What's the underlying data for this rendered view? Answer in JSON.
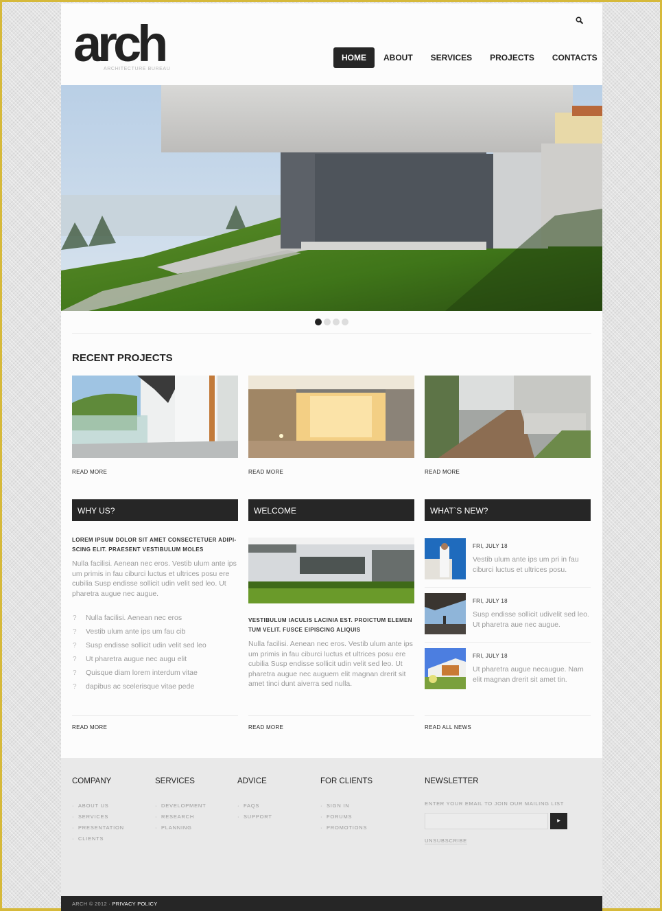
{
  "header": {
    "logo": "arch",
    "tagline": "ARCHITECTURE BUREAU",
    "search_icon": "search-icon",
    "nav": [
      {
        "label": "HOME",
        "active": true
      },
      {
        "label": "ABOUT",
        "active": false
      },
      {
        "label": "SERVICES",
        "active": false
      },
      {
        "label": "PROJECTS",
        "active": false
      },
      {
        "label": "CONTACTS",
        "active": false
      }
    ]
  },
  "slider": {
    "slide_count": 4,
    "active_slide": 1
  },
  "recent_projects": {
    "title": "RECENT PROJECTS",
    "items": [
      {
        "read_more": "READ MORE"
      },
      {
        "read_more": "READ MORE"
      },
      {
        "read_more": "READ MORE"
      }
    ]
  },
  "why_us": {
    "heading": "WHY US?",
    "lead": "LOREM IPSUM DOLOR SIT AMET CONSECTETUER ADIPI-SCING ELIT. PRAESENT VESTIBULUM MOLES",
    "body": "Nulla facilisi. Aenean nec eros. Vestib ulum ante ips um primis in fau ciburci luctus et ultrices posu ere cubilia Susp endisse sollicit udin velit sed leo. Ut pharetra augue nec augue.",
    "list": [
      "Nulla facilisi. Aenean nec eros",
      "Vestib ulum ante ips um fau cib",
      "Susp endisse sollicit udin velit sed leo",
      "Ut pharetra augue nec augu elit",
      "Quisque diam lorem interdum vitae",
      "dapibus ac scelerisque vitae pede"
    ],
    "list_bullet": "?",
    "read_more": "READ MORE"
  },
  "welcome": {
    "heading": "WELCOME",
    "lead": "VESTIBULUM IACULIS LACINIA EST. PROICTUM ELEMEN TUM VELIT. FUSCE EIPISCING ALIQUIS",
    "body": "Nulla facilisi. Aenean nec eros. Vestib ulum ante ips um primis in fau ciburci luctus et ultrices posu ere cubilia Susp endisse sollicit udin velit sed leo. Ut pharetra augue nec auguem elit magnan drerit sit amet tinci dunt aiverra sed nulla.",
    "read_more": "READ MORE"
  },
  "whats_new": {
    "heading": "WHAT`S NEW?",
    "items": [
      {
        "date": "FRI, JULY 18",
        "text": "Vestib ulum ante ips um pri in fau ciburci luctus et ultrices posu."
      },
      {
        "date": "FRI, JULY 18",
        "text": "Susp endisse sollicit udivelit sed leo. Ut pharetra aue nec augue."
      },
      {
        "date": "FRI, JULY 18",
        "text": "Ut pharetra augue necaugue. Nam elit magnan drerit sit amet tin."
      }
    ],
    "read_all": "READ ALL NEWS"
  },
  "footer": {
    "columns": [
      {
        "title": "COMPANY",
        "links": [
          "ABOUT US",
          "SERVICES",
          "PRESENTATION",
          "CLIENTS"
        ]
      },
      {
        "title": "SERVICES",
        "links": [
          "DEVELOPMENT",
          "RESEARCH",
          "PLANNING"
        ]
      },
      {
        "title": "ADVICE",
        "links": [
          "FAQS",
          "SUPPORT"
        ]
      },
      {
        "title": "FOR CLIENTS",
        "links": [
          "SIGN IN",
          "FORUMS",
          "PROMOTIONS"
        ]
      }
    ],
    "newsletter": {
      "title": "NEWSLETTER",
      "label": "ENTER YOUR EMAIL TO JOIN OUR MAILING LIST",
      "input_value": "",
      "submit_icon": "play-arrow-icon",
      "unsubscribe": "UNSUBSCRIBE"
    },
    "copyright": "ARCH © 2012 · ",
    "privacy": "PRIVACY POLICY"
  },
  "colors": {
    "dark": "#262626",
    "accent_border": "#d6b93a",
    "footer_bg": "#e9e9e9",
    "text_gray": "#9a9a9a"
  }
}
